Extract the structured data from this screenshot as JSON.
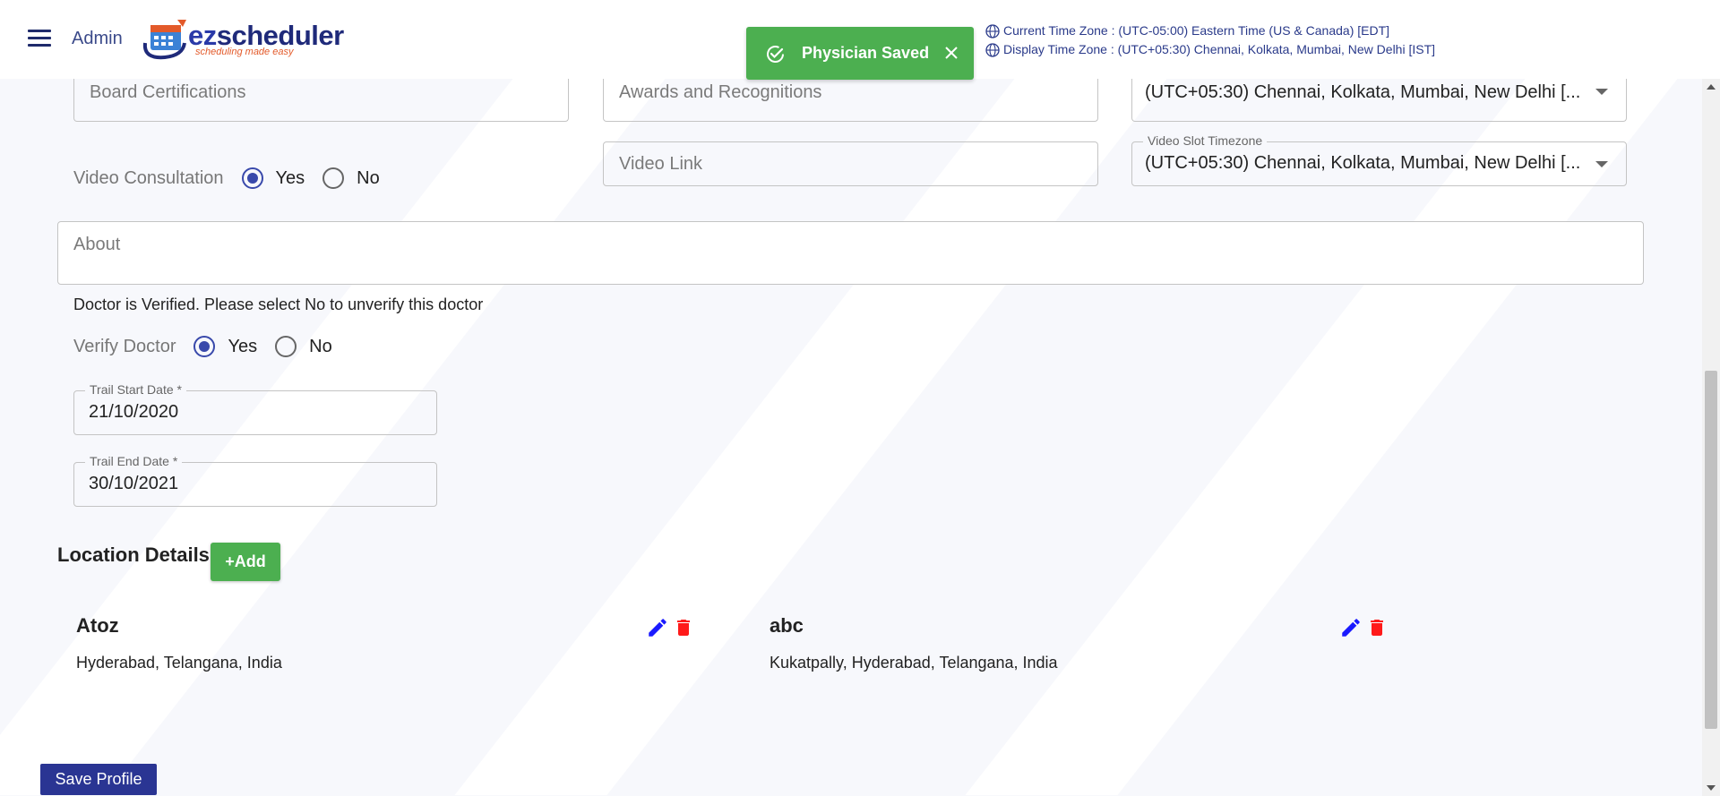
{
  "header": {
    "admin_label": "Admin",
    "logo": {
      "ez": "ez",
      "name": "scheduler",
      "tagline": "scheduling made easy"
    },
    "current_timezone": "Current Time Zone : (UTC-05:00) Eastern Time (US & Canada) [EDT]",
    "display_timezone": "Display Time Zone : (UTC+05:30) Chennai, Kolkata, Mumbai, New Delhi [IST]"
  },
  "toast": {
    "message": "Physician Saved"
  },
  "form": {
    "board_certifications_placeholder": "Board Certifications",
    "awards_placeholder": "Awards and Recognitions",
    "timezone_value": "(UTC+05:30) Chennai, Kolkata, Mumbai, New Delhi [...",
    "video_consultation_label": "Video Consultation",
    "video_consultation_value": "Yes",
    "yes_label": "Yes",
    "no_label": "No",
    "video_link_placeholder": "Video Link",
    "video_slot_timezone_label": "Video Slot Timezone",
    "video_slot_timezone_value": "(UTC+05:30) Chennai, Kolkata, Mumbai, New Delhi [...",
    "about_placeholder": "About",
    "verified_note": "Doctor is Verified. Please select No to unverify this doctor",
    "verify_doctor_label": "Verify Doctor",
    "verify_doctor_value": "Yes",
    "trail_start_label": "Trail Start Date *",
    "trail_start_value": "21/10/2020",
    "trail_end_label": "Trail End Date *",
    "trail_end_value": "30/10/2021"
  },
  "locations": {
    "title": "Location Details",
    "add_label": "+Add",
    "items": [
      {
        "name": "Atoz",
        "address": "Hyderabad, Telangana, India"
      },
      {
        "name": "abc",
        "address": "Kukatpally, Hyderabad, Telangana, India"
      }
    ]
  },
  "footer": {
    "save_label": "Save Profile"
  },
  "colors": {
    "primary": "#2a3593",
    "success": "#4caf50",
    "radio": "#3949ab",
    "edit": "#1a1aff",
    "delete": "#ff1a1a"
  }
}
